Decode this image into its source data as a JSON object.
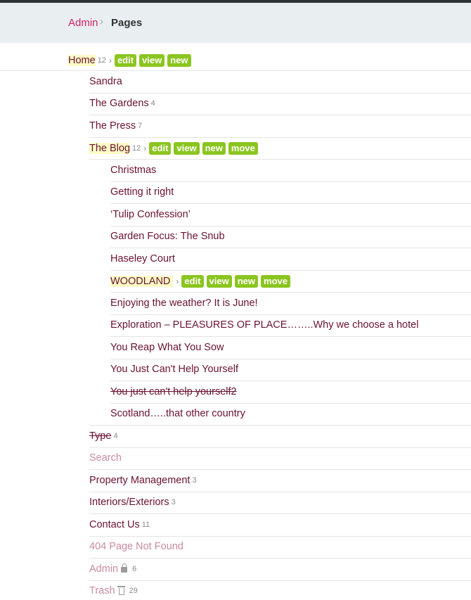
{
  "breadcrumb": {
    "admin": "Admin",
    "separator": "›",
    "current": "Pages"
  },
  "actions": {
    "edit": "edit",
    "view": "view",
    "new": "new",
    "move": "move"
  },
  "chevron": "›",
  "tree": {
    "home": {
      "title": "Home",
      "count": "12"
    },
    "level1_a": [
      {
        "title": "Sandra"
      },
      {
        "title": "The Gardens",
        "count": "4"
      },
      {
        "title": "The Press",
        "count": "7"
      }
    ],
    "blog": {
      "title": "The Blog",
      "count": "12"
    },
    "blog_children_a": [
      {
        "title": "Christmas"
      },
      {
        "title": "Getting it right"
      },
      {
        "title": "‘Tulip Confession’"
      },
      {
        "title": "Garden Focus: The Snub"
      },
      {
        "title": "Haseley Court"
      }
    ],
    "woodland": {
      "title": "WOODLAND"
    },
    "blog_children_b": [
      {
        "title": "Enjoying the weather? It is June!"
      },
      {
        "title": "Exploration – PLEASURES OF PLACE……..Why we choose a hotel"
      },
      {
        "title": "You Reap What You Sow"
      },
      {
        "title": "You Just Can't Help Yourself"
      },
      {
        "title": "You just can't help yourself2"
      },
      {
        "title": "Scotland…..that other country"
      }
    ],
    "level1_b": [
      {
        "title": "Type",
        "count": "4"
      },
      {
        "title": "Search"
      },
      {
        "title": "Property Management",
        "count": "3"
      },
      {
        "title": "Interiors/Exteriors",
        "count": "3"
      },
      {
        "title": "Contact Us",
        "count": "11"
      },
      {
        "title": "404 Page Not Found"
      },
      {
        "title": "Admin",
        "count": "6"
      },
      {
        "title": "Trash",
        "count": "29"
      }
    ]
  },
  "colors": {
    "link": "#6b1230",
    "accent": "#d22365",
    "badge": "#8bc51f",
    "muted_link": "#c98aa0",
    "highlight": "#fcfbc6"
  },
  "icons": {
    "admin": "lock-icon",
    "trash": "trash-icon"
  }
}
